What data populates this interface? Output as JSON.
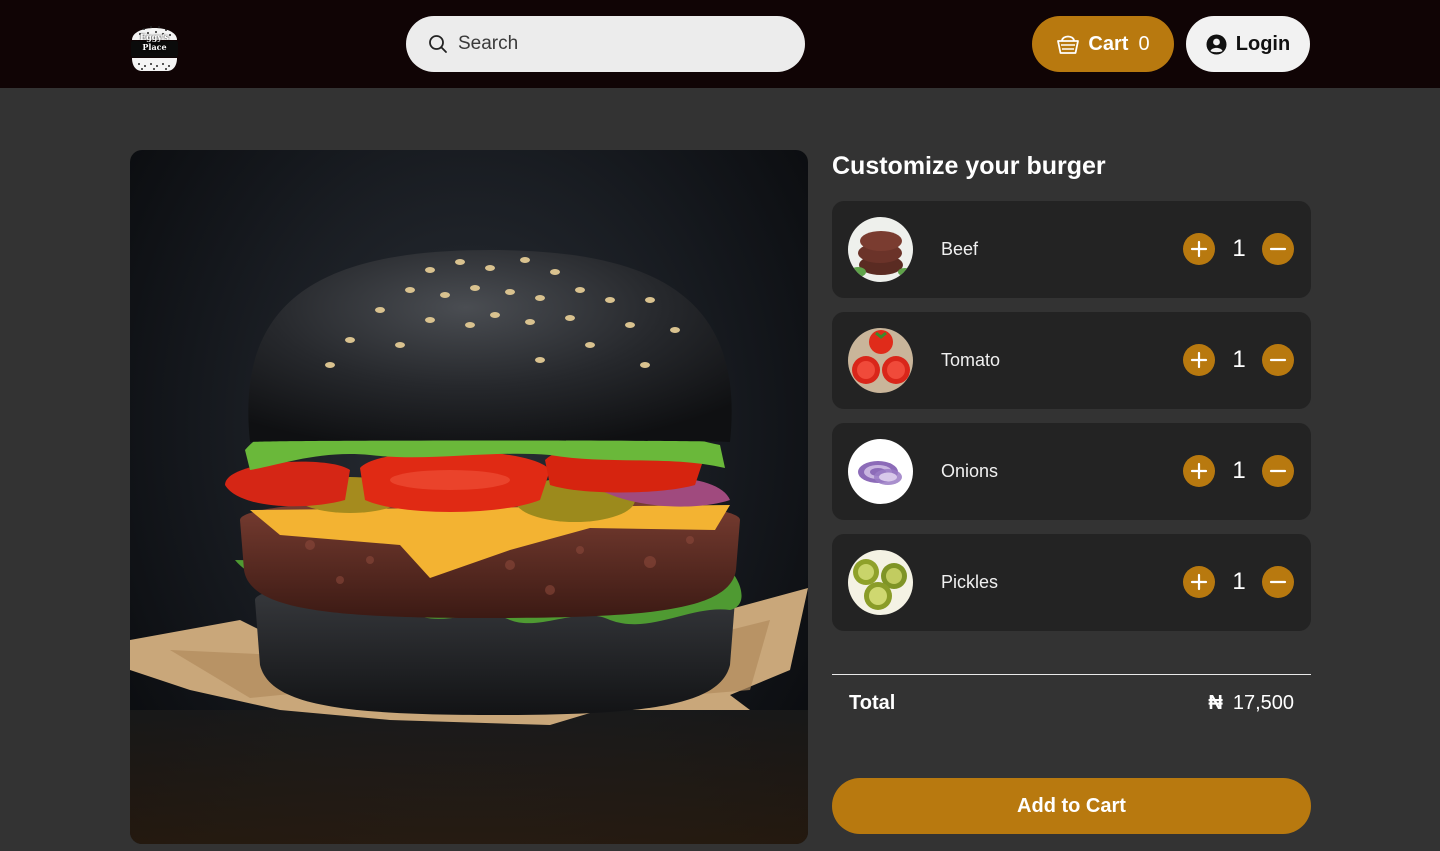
{
  "header": {
    "logo_text": "Eggy's\nPlace",
    "search": {
      "placeholder": "Search",
      "value": ""
    },
    "cart": {
      "label": "Cart",
      "count": "0"
    },
    "login": {
      "label": "Login"
    }
  },
  "customize": {
    "title": "Customize your burger",
    "ingredients": [
      {
        "name": "Beef",
        "quantity": "1",
        "icon": "beef-patty-image"
      },
      {
        "name": "Tomato",
        "quantity": "1",
        "icon": "tomato-image"
      },
      {
        "name": "Onions",
        "quantity": "1",
        "icon": "onion-image"
      },
      {
        "name": "Pickles",
        "quantity": "1",
        "icon": "pickle-image"
      }
    ]
  },
  "summary": {
    "total_label": "Total",
    "currency": "₦",
    "total_amount": "17,500"
  },
  "actions": {
    "add_to_cart": "Add to Cart"
  },
  "colors": {
    "accent": "#b8790f",
    "header_bg": "#100405",
    "page_bg": "#333333",
    "card_bg": "#232323"
  }
}
